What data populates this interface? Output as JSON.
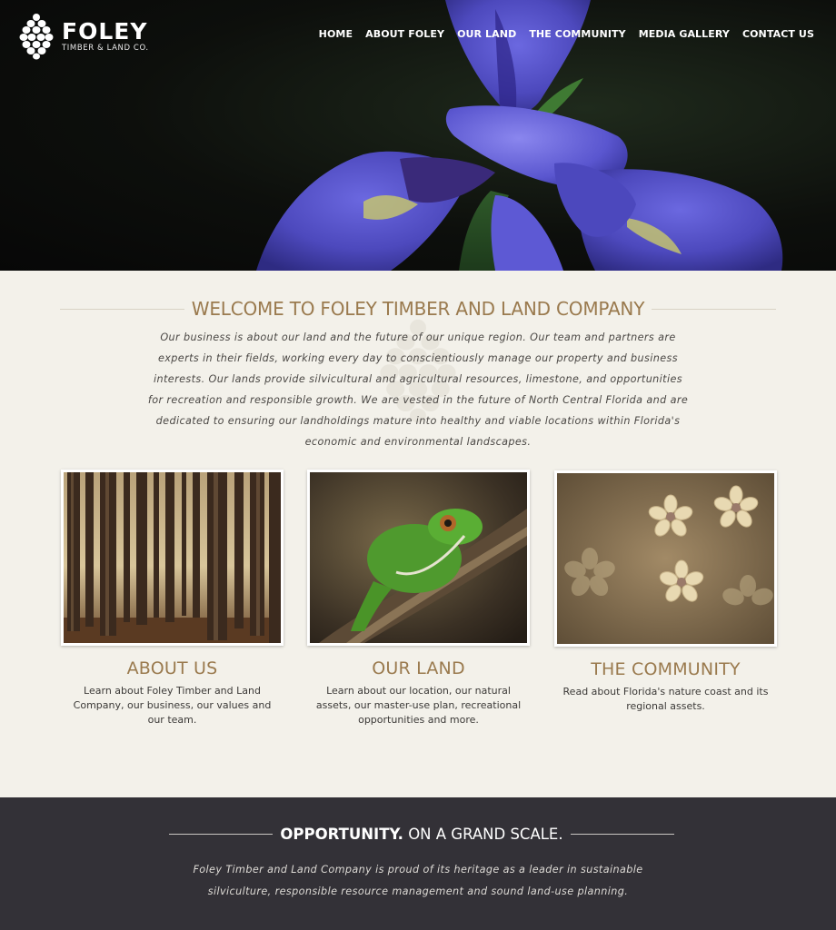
{
  "logo": {
    "name": "FOLEY",
    "subtitle": "TIMBER & LAND CO.",
    "icon": "pinecone-icon"
  },
  "nav": [
    {
      "label": "HOME"
    },
    {
      "label": "ABOUT FOLEY"
    },
    {
      "label": "OUR LAND"
    },
    {
      "label": "THE COMMUNITY"
    },
    {
      "label": "MEDIA GALLERY"
    },
    {
      "label": "CONTACT US"
    }
  ],
  "welcome": {
    "title": "WELCOME TO FOLEY TIMBER AND LAND COMPANY",
    "intro": "Our business is about our land and the future of our unique region. Our team and partners are experts in their fields, working every day to conscientiously manage our property and business interests. Our lands provide silvicultural and agricultural resources, limestone, and opportunities for recreation and responsible growth. We are vested in the future of North Central Florida and are dedicated to ensuring our landholdings mature into healthy and viable locations within Florida's economic and environmental landscapes."
  },
  "cards": [
    {
      "title": "ABOUT US",
      "text": "Learn about Foley Timber and Land Company, our business, our values and our team."
    },
    {
      "title": "OUR LAND",
      "text": "Learn about our location, our natural assets, our master-use plan, recreational opportunities and more."
    },
    {
      "title": "THE COMMUNITY",
      "text": "Read about Florida's nature coast and its regional assets."
    }
  ],
  "opportunity": {
    "title_bold": "OPPORTUNITY.",
    "title_rest": "ON A GRAND SCALE.",
    "text": "Foley Timber and Land Company is proud of its heritage as a leader in sustainable silviculture, responsible resource management and sound land-use planning."
  },
  "colors": {
    "accent_gold": "#9a7a4e",
    "page_background": "#f3f1ea",
    "footer_band": "#333137",
    "iris_purple": "#4f4bc0"
  }
}
